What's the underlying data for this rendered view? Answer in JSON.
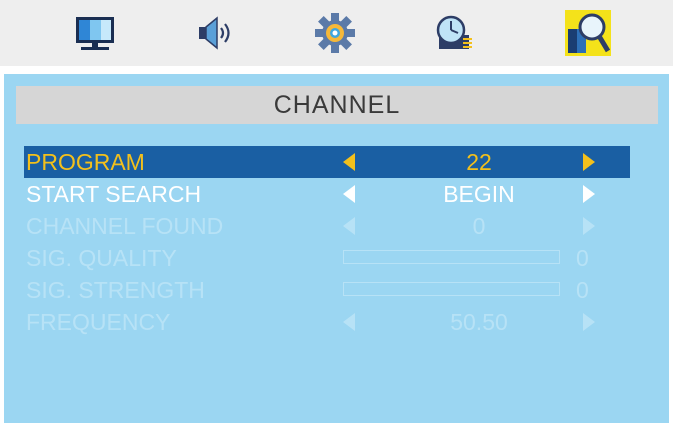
{
  "tabs": [
    {
      "icon": "monitor-icon",
      "active": false
    },
    {
      "icon": "speaker-icon",
      "active": false
    },
    {
      "icon": "gear-icon",
      "active": false
    },
    {
      "icon": "clock-icon",
      "active": false
    },
    {
      "icon": "channel-search-icon",
      "active": true
    }
  ],
  "panel": {
    "title": "CHANNEL",
    "rows": {
      "program": {
        "label": "PROGRAM",
        "value": "22"
      },
      "start_search": {
        "label": "START SEARCH",
        "value": "BEGIN"
      },
      "channel_found": {
        "label": "CHANNEL FOUND",
        "value": "0"
      },
      "sig_quality": {
        "label": "SIG. QUALITY",
        "value": "0",
        "level": 0
      },
      "sig_strength": {
        "label": "SIG. STRENGTH",
        "value": "0",
        "level": 0
      },
      "frequency": {
        "label": "FREQUENCY",
        "value": "50.50"
      }
    }
  },
  "colors": {
    "panel_bg": "#9bd6f2",
    "header_bg": "#d6d6d6",
    "selected_row": "#1a5fa3",
    "highlight_text": "#f3c01c",
    "active_text": "#ffffff",
    "disabled_text": "#b7e2f6",
    "active_tab": "#f4e21a"
  }
}
